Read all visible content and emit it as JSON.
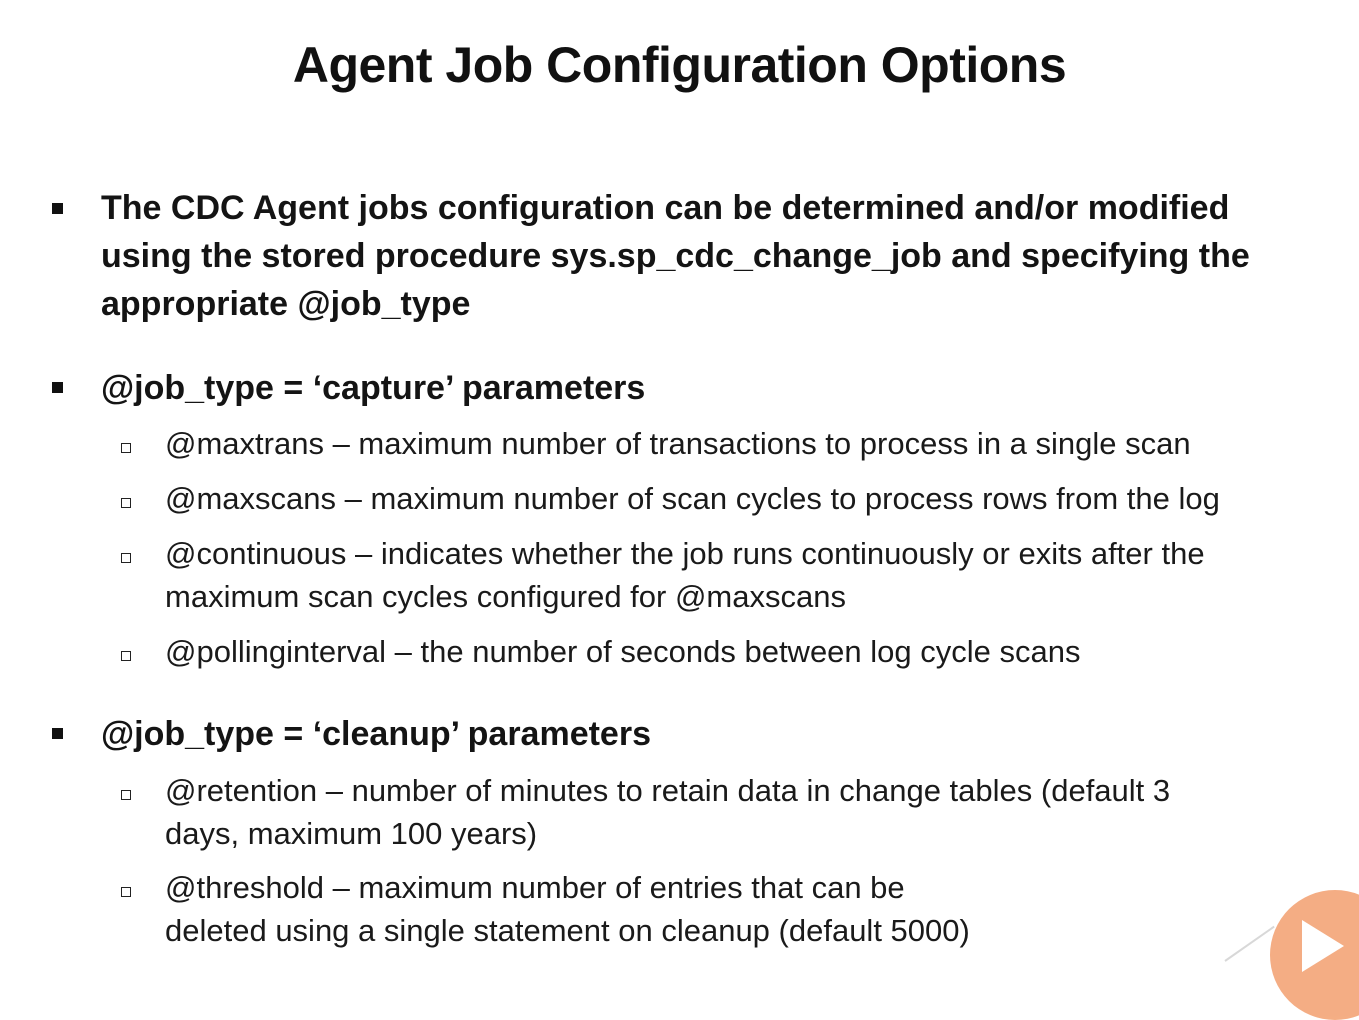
{
  "title": "Agent Job Configuration Options",
  "bullets": [
    {
      "lines": [
        "The CDC Agent jobs configuration can be determined and/or modified",
        "using the stored procedure sys.sp_cdc_change_job and specifying the",
        "appropriate @job_type"
      ]
    },
    {
      "text": "@job_type = ‘capture’ parameters",
      "sub": [
        {
          "lines": [
            "@maxtrans – maximum number of transactions to process in a single scan"
          ]
        },
        {
          "lines": [
            "@maxscans – maximum number of scan cycles to process rows from the log"
          ]
        },
        {
          "lines": [
            "@continuous – indicates whether the job runs continuously or exits after the",
            "maximum scan cycles configured for @maxscans"
          ]
        },
        {
          "lines": [
            "@pollinginterval – the number of seconds between log cycle scans"
          ]
        }
      ]
    },
    {
      "text": "@job_type = ‘cleanup’ parameters",
      "sub": [
        {
          "lines": [
            "@retention – number of minutes to retain data in change tables (default 3",
            "days, maximum 100 years)"
          ]
        },
        {
          "lines": [
            "@threshold – maximum number of entries that can be",
            "deleted using a single statement on cleanup (default 5000)"
          ]
        }
      ]
    }
  ],
  "icons": {
    "play": "play-icon"
  },
  "colors": {
    "text": "#141414",
    "play_button": "#f4a77a"
  }
}
